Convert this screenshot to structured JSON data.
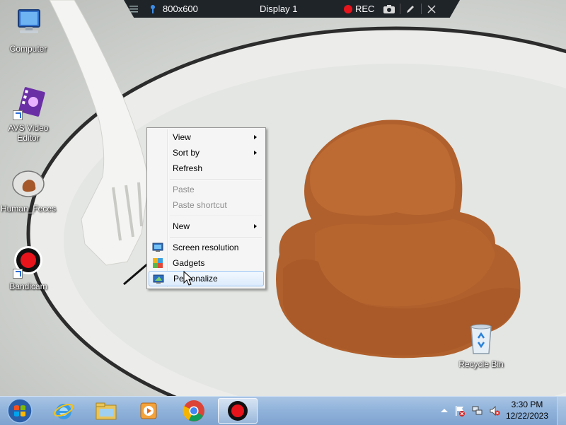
{
  "recorder_bar": {
    "resolution": "800x600",
    "display": "Display 1",
    "rec_label": "REC"
  },
  "desktop_icons": [
    {
      "label": "Computer"
    },
    {
      "label": "AVS Video Editor"
    },
    {
      "label": "Human_Feces"
    },
    {
      "label": "Bandicam"
    },
    {
      "label": "Recycle Bin"
    }
  ],
  "context_menu": {
    "items": [
      {
        "label": "View",
        "submenu": true,
        "enabled": true
      },
      {
        "label": "Sort by",
        "submenu": true,
        "enabled": true
      },
      {
        "label": "Refresh",
        "submenu": false,
        "enabled": true
      },
      {
        "label": "Paste",
        "submenu": false,
        "enabled": false
      },
      {
        "label": "Paste shortcut",
        "submenu": false,
        "enabled": false
      },
      {
        "label": "New",
        "submenu": true,
        "enabled": true
      },
      {
        "label": "Screen resolution",
        "submenu": false,
        "enabled": true,
        "icon": "monitor-icon"
      },
      {
        "label": "Gadgets",
        "submenu": false,
        "enabled": true,
        "icon": "gadgets-icon"
      },
      {
        "label": "Personalize",
        "submenu": false,
        "enabled": true,
        "icon": "personalize-icon",
        "highlighted": true
      }
    ]
  },
  "taskbar": {
    "start": "windows-start-icon",
    "pinned": [
      "internet-explorer-icon",
      "windows-explorer-icon",
      "media-player-icon",
      "chrome-icon",
      "bandicam-icon"
    ],
    "active": "bandicam-icon",
    "tray_icons": [
      "show-hidden-icons-icon",
      "action-center-flag-icon",
      "network-icon",
      "volume-muted-icon"
    ],
    "clock": {
      "time": "3:30 PM",
      "date": "12/22/2023"
    }
  },
  "colors": {
    "recorder_bg": "#1f2429",
    "rec_red": "#e8141c",
    "menu_bg": "#f5f5f5",
    "menu_hover_border": "#99c4f2",
    "taskbar": "#8fb2da"
  }
}
